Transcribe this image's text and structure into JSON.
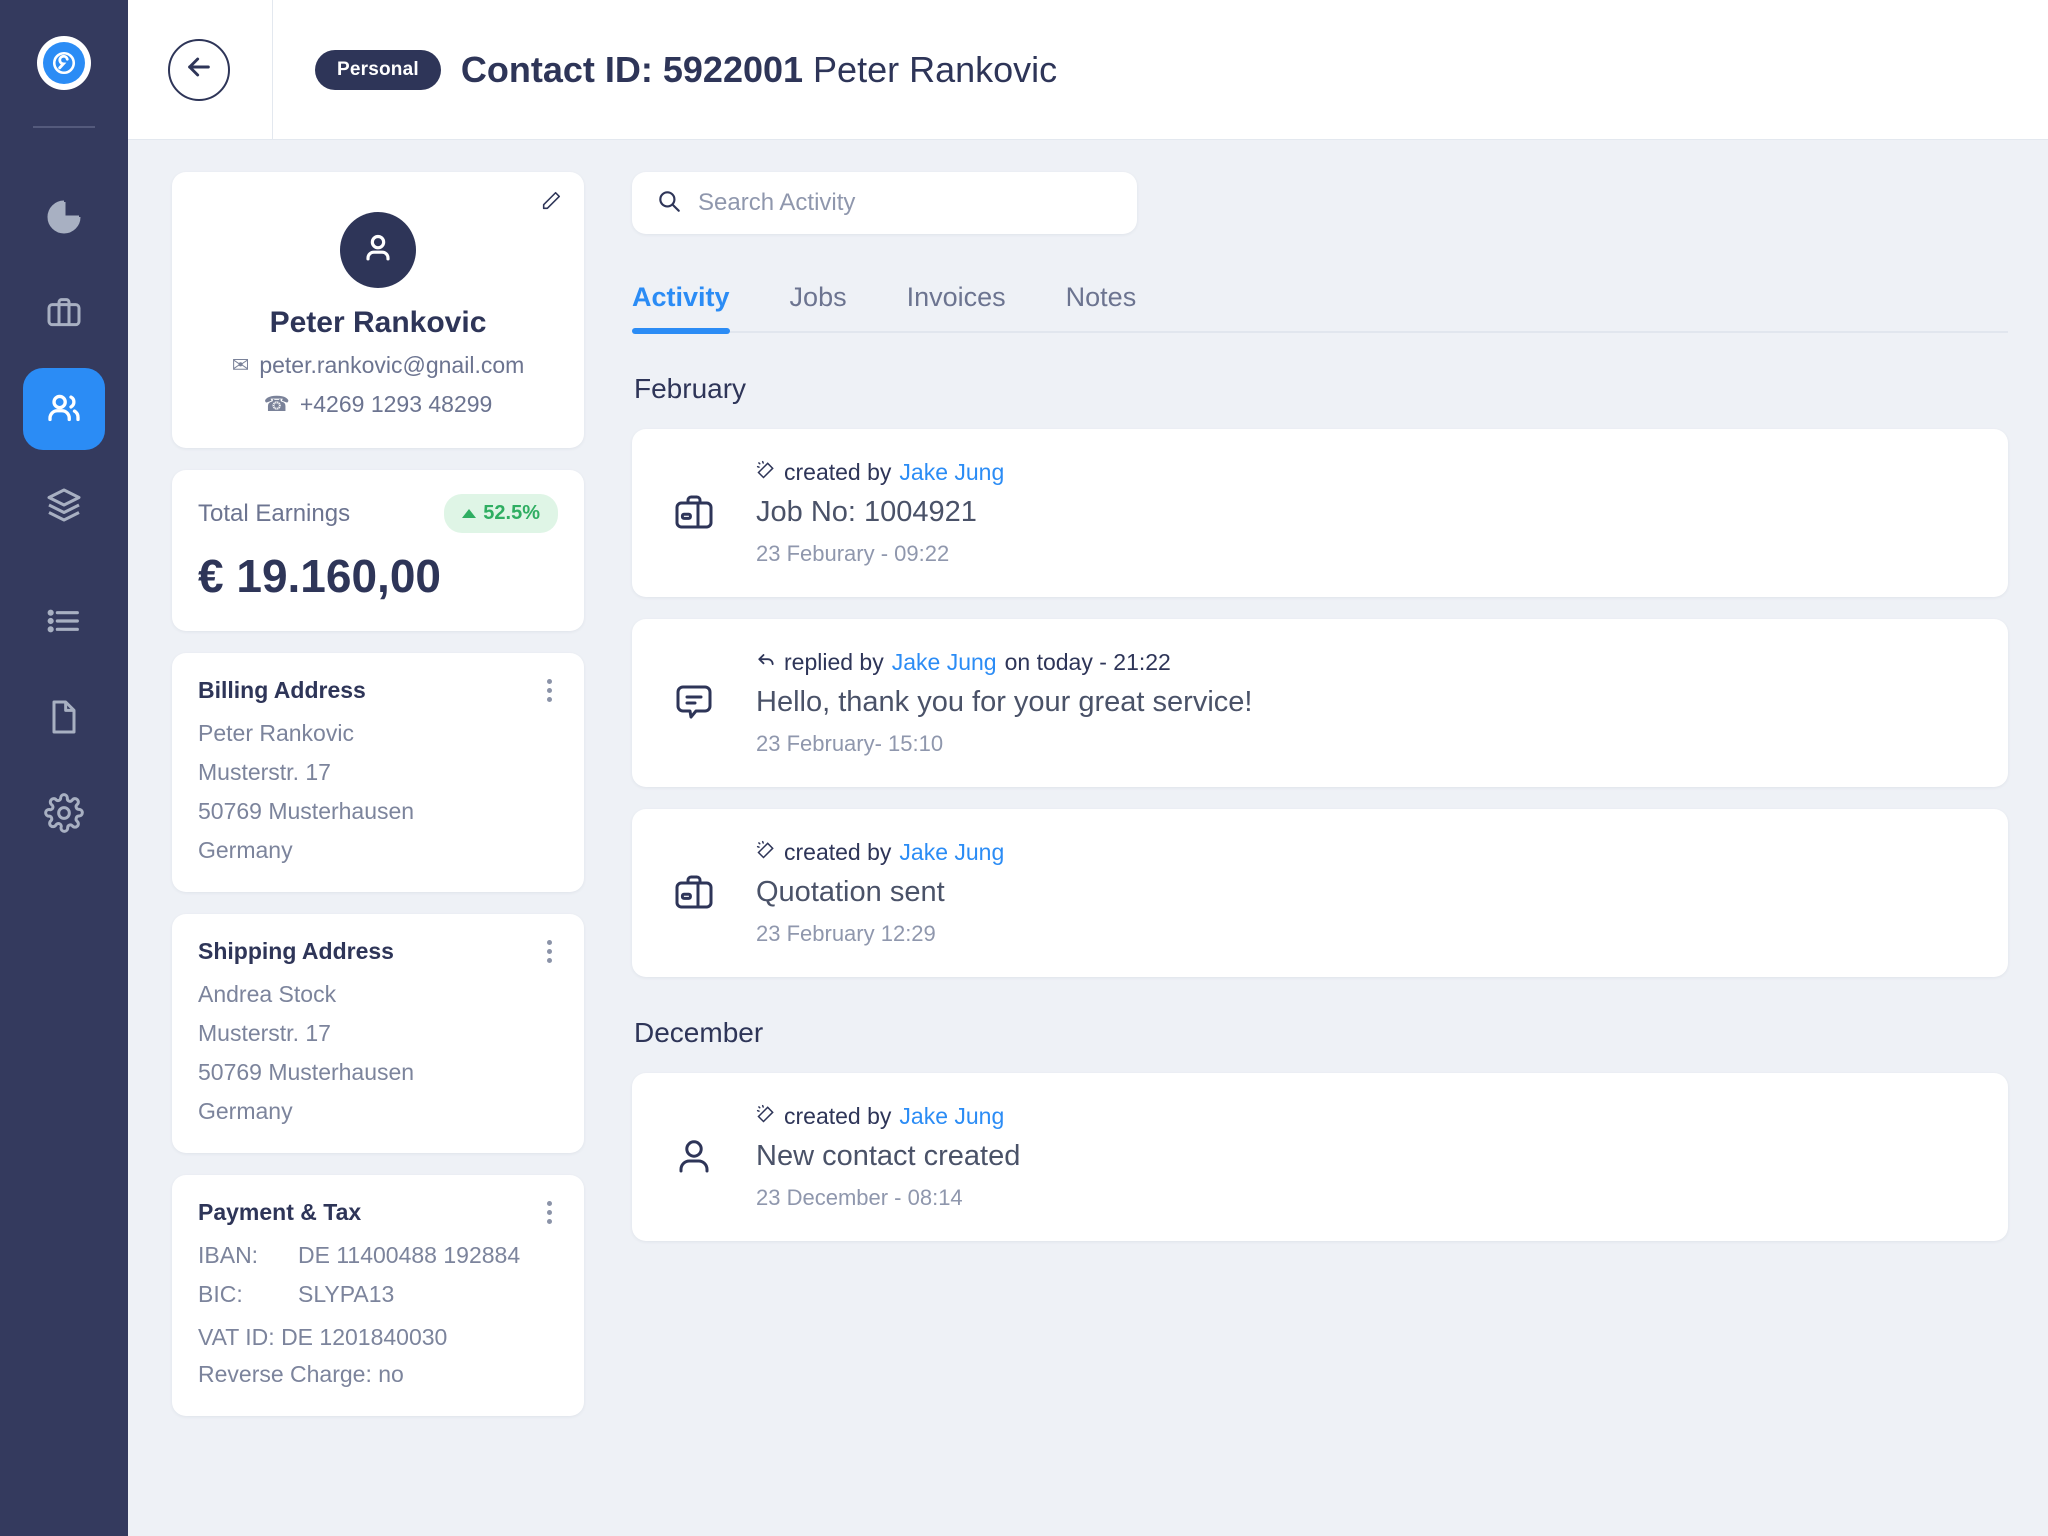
{
  "sidebar": {
    "brand_name": "app-logo",
    "items": [
      {
        "name": "analytics",
        "icon": "pie-chart-icon",
        "active": false
      },
      {
        "name": "jobs",
        "icon": "briefcase-icon",
        "active": false
      },
      {
        "name": "contacts",
        "icon": "users-icon",
        "active": true
      },
      {
        "name": "layers",
        "icon": "layers-icon",
        "active": false
      },
      {
        "name": "lists",
        "icon": "list-icon",
        "active": false
      },
      {
        "name": "documents",
        "icon": "document-icon",
        "active": false
      },
      {
        "name": "settings",
        "icon": "gear-icon",
        "active": false
      }
    ]
  },
  "header": {
    "back_icon": "arrow-left-icon",
    "chip": "Personal",
    "title_prefix": "Contact ID:",
    "contact_id": "5922001",
    "contact_name": "Peter Rankovic"
  },
  "profile": {
    "edit_icon": "pencil-icon",
    "avatar_icon": "person-icon",
    "name": "Peter Rankovic",
    "email_icon": "envelope-icon",
    "email": "peter.rankovic@gnail.com",
    "phone_icon": "phone-icon",
    "phone": "+4269 1293 48299"
  },
  "earnings": {
    "label": "Total Earnings",
    "change": "52.5%",
    "trend": "up",
    "value": "€ 19.160,00",
    "badge_bg": "#dff5e6",
    "badge_fg": "#2fae62"
  },
  "billing": {
    "title": "Billing Address",
    "lines": [
      "Peter  Rankovic",
      "Musterstr.  17",
      "50769 Musterhausen",
      "Germany"
    ]
  },
  "shipping": {
    "title": "Shipping Address",
    "lines": [
      "Andrea Stock",
      "Musterstr. 17",
      "50769 Musterhausen",
      "Germany"
    ]
  },
  "payment": {
    "title": "Payment & Tax",
    "rows": [
      {
        "key": "IBAN:",
        "value": "DE 11400488 192884"
      },
      {
        "key": "BIC:",
        "value": "SLYPA13"
      }
    ],
    "vat": "VAT ID: DE 1201840030",
    "reverse_charge": "Reverse Charge: no"
  },
  "search": {
    "icon": "search-icon",
    "placeholder": "Search Activity",
    "value": ""
  },
  "tabs": [
    {
      "label": "Activity",
      "active": true
    },
    {
      "label": "Jobs",
      "active": false
    },
    {
      "label": "Invoices",
      "active": false
    },
    {
      "label": "Notes",
      "active": false
    }
  ],
  "activity_groups": [
    {
      "month": "February",
      "items": [
        {
          "icon": "briefcase-icon",
          "meta_icon": "magic-wand-icon",
          "meta_prefix": "created by",
          "who": "Jake Jung",
          "meta_suffix": "",
          "title": "Job No: 1004921",
          "time": "23 Feburary - 09:22"
        },
        {
          "icon": "chat-bubble-icon",
          "meta_icon": "reply-arrow-icon",
          "meta_prefix": "replied by",
          "who": "Jake Jung",
          "meta_suffix": "on today - 21:22",
          "title": "Hello, thank you for your great service!",
          "time": "23 February- 15:10"
        },
        {
          "icon": "briefcase-icon",
          "meta_icon": "magic-wand-icon",
          "meta_prefix": "created by",
          "who": "Jake Jung",
          "meta_suffix": "",
          "title": "Quotation sent",
          "time": "23 February  12:29"
        }
      ]
    },
    {
      "month": "December",
      "items": [
        {
          "icon": "person-icon",
          "meta_icon": "magic-wand-icon",
          "meta_prefix": "created by",
          "who": "Jake Jung",
          "meta_suffix": "",
          "title": "New contact created",
          "time": "23 December - 08:14"
        }
      ]
    }
  ],
  "colors": {
    "sidebar": "#343a5e",
    "accent": "#2b8cf5",
    "dark": "#2e3558",
    "bg": "#eef1f6"
  }
}
